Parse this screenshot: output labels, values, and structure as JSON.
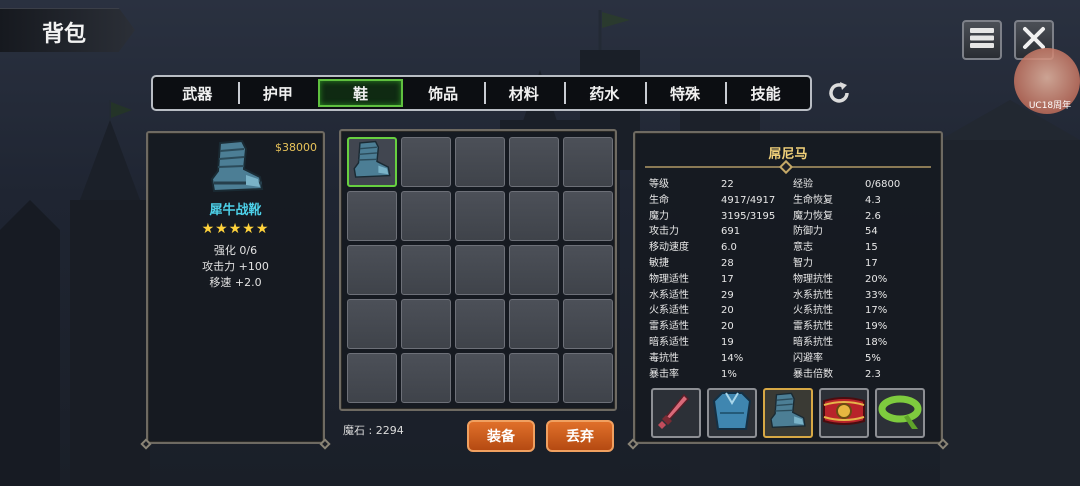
{
  "header": {
    "title": "背包"
  },
  "toolbar": {
    "menu_icon": "menu-icon",
    "close_icon": "close-icon"
  },
  "avatar": {
    "label": "UC18周年"
  },
  "tabs": [
    {
      "label": "武器",
      "active": false
    },
    {
      "label": "护甲",
      "active": false
    },
    {
      "label": "鞋",
      "active": true
    },
    {
      "label": "饰品",
      "active": false
    },
    {
      "label": "材料",
      "active": false
    },
    {
      "label": "药水",
      "active": false
    },
    {
      "label": "特殊",
      "active": false
    },
    {
      "label": "技能",
      "active": false
    }
  ],
  "item_detail": {
    "price": "$38000",
    "name": "犀牛战靴",
    "stars": "★★★★★",
    "stats": [
      "强化 0/6",
      "攻击力  +100",
      "移速  +2.0"
    ]
  },
  "inventory": {
    "rows": 5,
    "cols": 5,
    "items": [
      "boots"
    ],
    "gems_text": "魔石 : 2294"
  },
  "actions": {
    "equip_label": "装备",
    "discard_label": "丢弃"
  },
  "character": {
    "name": "屌尼马",
    "stats": [
      [
        "等级",
        "22",
        "经验",
        "0/6800"
      ],
      [
        "生命",
        "4917/4917",
        "生命恢复",
        "4.3"
      ],
      [
        "魔力",
        "3195/3195",
        "魔力恢复",
        "2.6"
      ],
      [
        "攻击力",
        "691",
        "防御力",
        "54"
      ],
      [
        "移动速度",
        "6.0",
        "意志",
        "15"
      ],
      [
        "敏捷",
        "28",
        "智力",
        "17"
      ],
      [
        "物理适性",
        "17",
        "物理抗性",
        "20%"
      ],
      [
        "水系适性",
        "29",
        "水系抗性",
        "33%"
      ],
      [
        "火系适性",
        "20",
        "火系抗性",
        "17%"
      ],
      [
        "雷系适性",
        "20",
        "雷系抗性",
        "19%"
      ],
      [
        "暗系适性",
        "19",
        "暗系抗性",
        "18%"
      ],
      [
        "毒抗性",
        "14%",
        "闪避率",
        "5%"
      ],
      [
        "暴击率",
        "1%",
        "暴击倍数",
        "2.3"
      ]
    ],
    "equipment": [
      "dagger-icon",
      "armor-icon",
      "boots-icon",
      "belt-red-icon",
      "belt-green-icon"
    ]
  }
}
